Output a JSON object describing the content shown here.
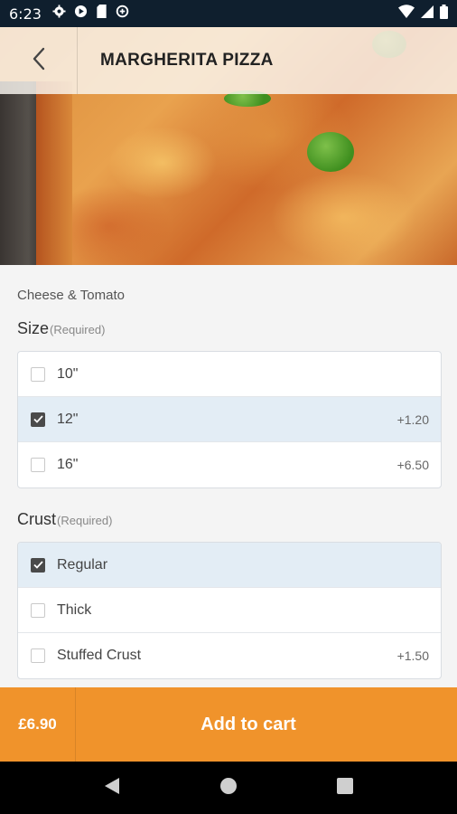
{
  "status_bar": {
    "time": "6:23",
    "left_icons": [
      "gear-icon",
      "play-protect-icon",
      "sd-card-icon",
      "data-saver-icon"
    ],
    "right_icons": [
      "wifi-icon",
      "signal-icon",
      "battery-icon"
    ]
  },
  "header": {
    "title": "MARGHERITA PIZZA",
    "back_icon": "chevron-left-icon"
  },
  "item": {
    "description": "Cheese & Tomato"
  },
  "sections": [
    {
      "title": "Size",
      "required_label": "(Required)",
      "options": [
        {
          "label": "10\"",
          "price": "",
          "selected": false
        },
        {
          "label": "12\"",
          "price": "+1.20",
          "selected": true
        },
        {
          "label": "16\"",
          "price": "+6.50",
          "selected": false
        }
      ]
    },
    {
      "title": "Crust",
      "required_label": "(Required)",
      "options": [
        {
          "label": "Regular",
          "price": "",
          "selected": true
        },
        {
          "label": "Thick",
          "price": "",
          "selected": false
        },
        {
          "label": "Stuffed Crust",
          "price": "+1.50",
          "selected": false
        }
      ]
    }
  ],
  "cart": {
    "price": "£6.90",
    "button_label": "Add to cart"
  },
  "nav_bar": {
    "icons": [
      "back-triangle-icon",
      "home-circle-icon",
      "recents-square-icon"
    ]
  },
  "colors": {
    "accent": "#f0932b",
    "selected_row": "#e3edf5",
    "status_bar": "#0f1f2e"
  }
}
